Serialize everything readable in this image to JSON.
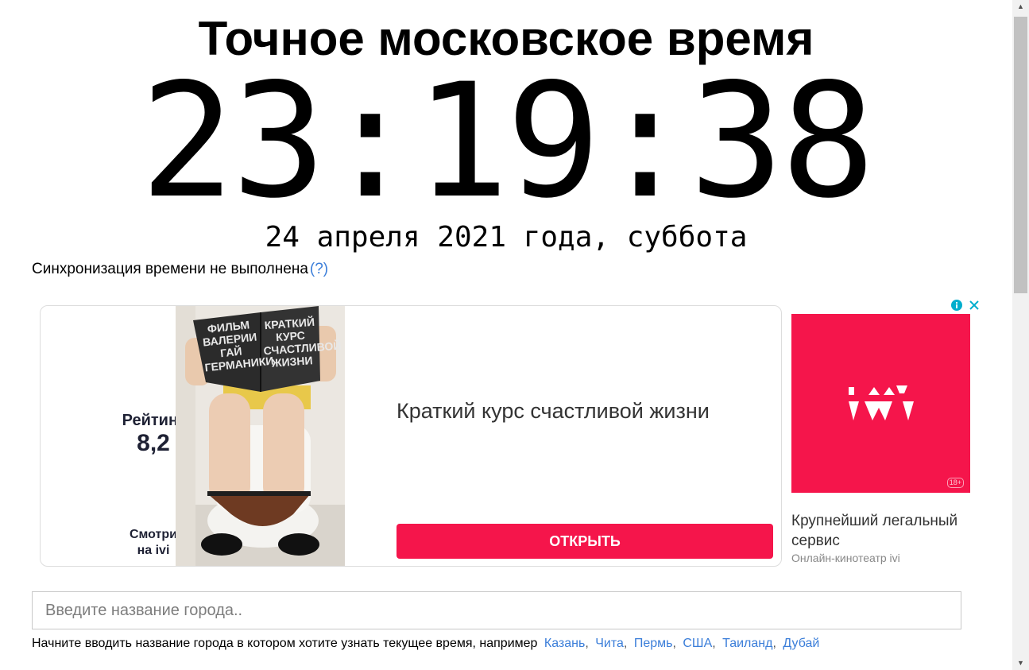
{
  "page": {
    "title": "Точное московское время",
    "clock": "23:19:38",
    "date": "24 апреля 2021 года, суббота",
    "sync_status": "Синхронизация времени не выполнена",
    "sync_help": "(?)"
  },
  "ad": {
    "rating_label": "Рейтинг",
    "rating_value": "8,2",
    "watch_label_line1": "Смотри",
    "watch_label_line2": "на ivi",
    "poster_book_left": [
      "ФИЛЬМ",
      "ВАЛЕРИИ",
      "ГАЙ",
      "ГЕРМАНИКИ"
    ],
    "poster_book_right": [
      "КРАТКИЙ",
      "КУРС",
      "СЧАСТЛИВОЙ",
      "ЖИЗНИ"
    ],
    "headline": "Краткий курс счастливой жизни",
    "open_button": "ОТКРЫТЬ",
    "brand_color": "#f5154b",
    "side_logo": "ivi",
    "side_age": "18+",
    "side_title": "Крупнейший легальный сервис",
    "side_subtitle": "Онлайн-кинотеатр ivi"
  },
  "search": {
    "placeholder": "Введите название города..",
    "value": ""
  },
  "hint": {
    "text": "Начните вводить название города в котором хотите узнать текущее время, например",
    "examples": [
      "Казань",
      "Чита",
      "Пермь",
      "США",
      "Таиланд",
      "Дубай"
    ],
    "link_color": "#3b7ed9"
  }
}
